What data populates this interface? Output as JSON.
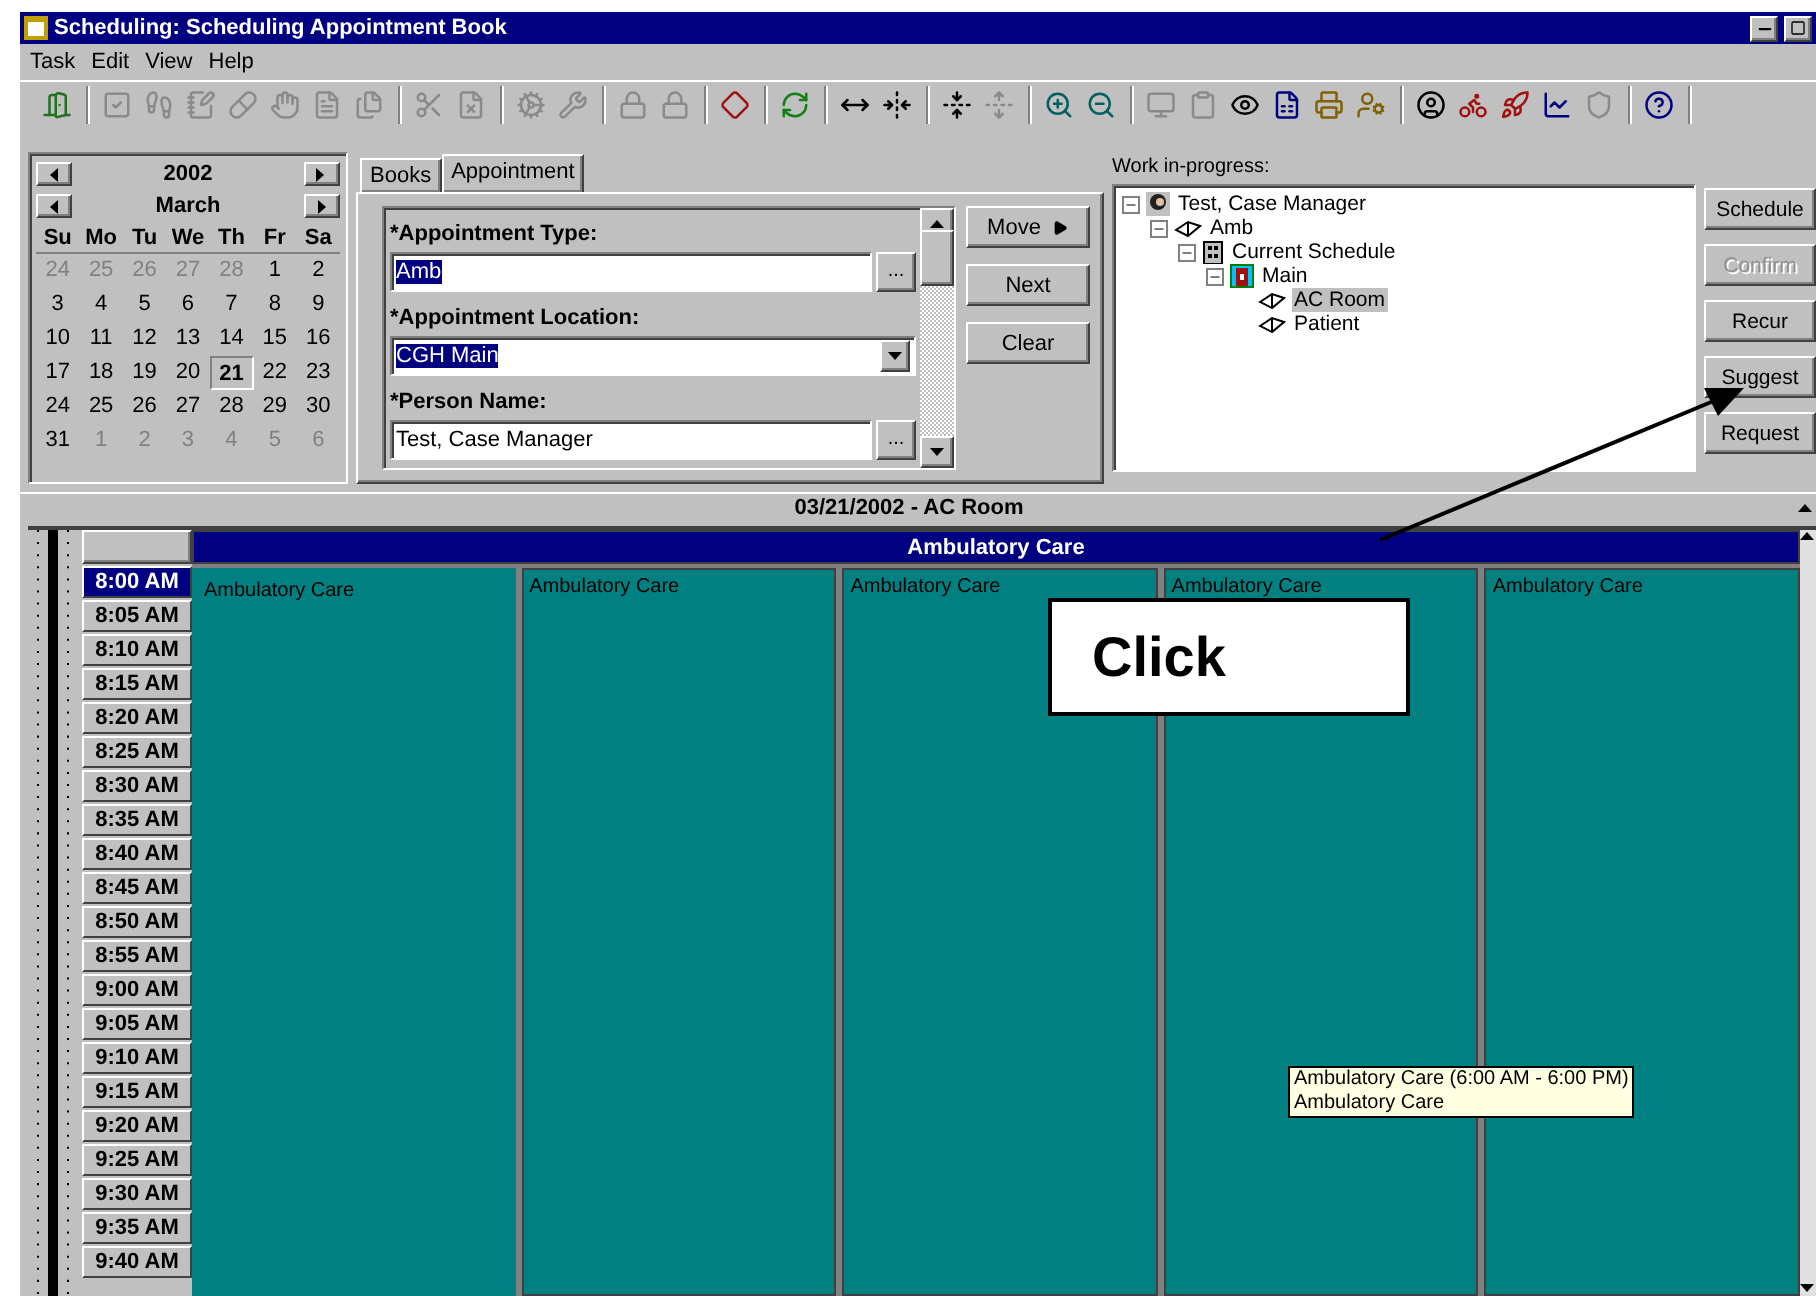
{
  "window": {
    "title": "Scheduling: Scheduling Appointment Book"
  },
  "menu": [
    "Task",
    "Edit",
    "View",
    "Help"
  ],
  "toolbar": [
    {
      "buttons": [
        {
          "disabled": false
        }
      ]
    },
    {
      "buttons": [
        {
          "disabled": true
        },
        {
          "disabled": true
        },
        {
          "disabled": true
        },
        {
          "disabled": true
        },
        {
          "disabled": true
        },
        {
          "disabled": true
        },
        {
          "disabled": true
        }
      ]
    },
    {
      "buttons": [
        {
          "disabled": true
        },
        {
          "disabled": true
        }
      ]
    },
    {
      "buttons": [
        {
          "disabled": true
        },
        {
          "disabled": true
        }
      ]
    },
    {
      "buttons": [
        {
          "disabled": true
        },
        {
          "disabled": true
        }
      ]
    },
    {
      "buttons": [
        {
          "disabled": false
        }
      ]
    },
    {
      "buttons": [
        {
          "disabled": false
        }
      ]
    },
    {
      "buttons": [
        {
          "disabled": false
        },
        {
          "disabled": false
        }
      ]
    },
    {
      "buttons": [
        {
          "disabled": false
        },
        {
          "disabled": true
        }
      ]
    },
    {
      "buttons": [
        {
          "disabled": false
        },
        {
          "disabled": false
        }
      ]
    },
    {
      "buttons": [
        {
          "disabled": true
        },
        {
          "disabled": true
        },
        {
          "disabled": false
        },
        {
          "disabled": false
        },
        {
          "disabled": false
        },
        {
          "disabled": false
        }
      ]
    },
    {
      "buttons": [
        {
          "disabled": false
        },
        {
          "disabled": false
        },
        {
          "disabled": false
        },
        {
          "disabled": false
        },
        {
          "disabled": true
        }
      ]
    },
    {
      "buttons": [
        {
          "disabled": false
        }
      ]
    }
  ],
  "calendar": {
    "year": "2002",
    "month": "March",
    "weekdays": [
      "Su",
      "Mo",
      "Tu",
      "We",
      "Th",
      "Fr",
      "Sa"
    ],
    "days": [
      {
        "label": "24",
        "other_month": true,
        "selected": false
      },
      {
        "label": "25",
        "other_month": true,
        "selected": false
      },
      {
        "label": "26",
        "other_month": true,
        "selected": false
      },
      {
        "label": "27",
        "other_month": true,
        "selected": false
      },
      {
        "label": "28",
        "other_month": true,
        "selected": false
      },
      {
        "label": "1",
        "other_month": false,
        "selected": false
      },
      {
        "label": "2",
        "other_month": false,
        "selected": false
      },
      {
        "label": "3",
        "other_month": false,
        "selected": false
      },
      {
        "label": "4",
        "other_month": false,
        "selected": false
      },
      {
        "label": "5",
        "other_month": false,
        "selected": false
      },
      {
        "label": "6",
        "other_month": false,
        "selected": false
      },
      {
        "label": "7",
        "other_month": false,
        "selected": false
      },
      {
        "label": "8",
        "other_month": false,
        "selected": false
      },
      {
        "label": "9",
        "other_month": false,
        "selected": false
      },
      {
        "label": "10",
        "other_month": false,
        "selected": false
      },
      {
        "label": "11",
        "other_month": false,
        "selected": false
      },
      {
        "label": "12",
        "other_month": false,
        "selected": false
      },
      {
        "label": "13",
        "other_month": false,
        "selected": false
      },
      {
        "label": "14",
        "other_month": false,
        "selected": false
      },
      {
        "label": "15",
        "other_month": false,
        "selected": false
      },
      {
        "label": "16",
        "other_month": false,
        "selected": false
      },
      {
        "label": "17",
        "other_month": false,
        "selected": false
      },
      {
        "label": "18",
        "other_month": false,
        "selected": false
      },
      {
        "label": "19",
        "other_month": false,
        "selected": false
      },
      {
        "label": "20",
        "other_month": false,
        "selected": false
      },
      {
        "label": "21",
        "other_month": false,
        "selected": true
      },
      {
        "label": "22",
        "other_month": false,
        "selected": false
      },
      {
        "label": "23",
        "other_month": false,
        "selected": false
      },
      {
        "label": "24",
        "other_month": false,
        "selected": false
      },
      {
        "label": "25",
        "other_month": false,
        "selected": false
      },
      {
        "label": "26",
        "other_month": false,
        "selected": false
      },
      {
        "label": "27",
        "other_month": false,
        "selected": false
      },
      {
        "label": "28",
        "other_month": false,
        "selected": false
      },
      {
        "label": "29",
        "other_month": false,
        "selected": false
      },
      {
        "label": "30",
        "other_month": false,
        "selected": false
      },
      {
        "label": "31",
        "other_month": false,
        "selected": false
      },
      {
        "label": "1",
        "other_month": true,
        "selected": false
      },
      {
        "label": "2",
        "other_month": true,
        "selected": false
      },
      {
        "label": "3",
        "other_month": true,
        "selected": false
      },
      {
        "label": "4",
        "other_month": true,
        "selected": false
      },
      {
        "label": "5",
        "other_month": true,
        "selected": false
      },
      {
        "label": "6",
        "other_month": true,
        "selected": false
      }
    ]
  },
  "tabs": [
    {
      "label": "Books",
      "selected": false
    },
    {
      "label": "Appointment",
      "selected": true
    }
  ],
  "form": {
    "fields": [
      {
        "label": "*Appointment Type:",
        "value": "Amb",
        "kind": "lookup",
        "highlighted": true,
        "button": "..."
      },
      {
        "label": "*Appointment Location:",
        "value": "CGH Main",
        "kind": "dropdown",
        "highlighted": true
      },
      {
        "label": "*Person Name:",
        "value": "Test, Case Manager",
        "kind": "lookup",
        "highlighted": false,
        "button": "..."
      }
    ]
  },
  "form_buttons": [
    {
      "label": "Move",
      "arrow": true
    },
    {
      "label": "Next",
      "arrow": false
    },
    {
      "label": "Clear",
      "arrow": false
    }
  ],
  "work_in_progress": {
    "label": "Work in-progress:",
    "tree": [
      {
        "label": "Test, Case Manager",
        "kind": "person",
        "selected": false,
        "expanded": true,
        "children": [
          {
            "label": "Amb",
            "kind": "book",
            "selected": false,
            "expanded": true,
            "children": [
              {
                "label": "Current Schedule",
                "kind": "building",
                "selected": false,
                "expanded": true,
                "children": [
                  {
                    "label": "Main",
                    "kind": "location",
                    "selected": false,
                    "expanded": true,
                    "children": [
                      {
                        "label": "AC Room",
                        "kind": "book",
                        "selected": true
                      },
                      {
                        "label": "Patient",
                        "kind": "book",
                        "selected": false
                      }
                    ]
                  }
                ]
              }
            ]
          }
        ]
      }
    ]
  },
  "side_buttons": [
    {
      "label": "Schedule",
      "disabled": false
    },
    {
      "label": "Confirm",
      "disabled": true
    },
    {
      "label": "Recur",
      "disabled": false
    },
    {
      "label": "Suggest",
      "disabled": false
    },
    {
      "label": "Request",
      "disabled": false
    }
  ],
  "schedule": {
    "title": "03/21/2002 - AC Room",
    "header": "Ambulatory Care",
    "times": [
      {
        "label": "8:00 AM",
        "selected": true
      },
      {
        "label": "8:05 AM",
        "selected": false
      },
      {
        "label": "8:10 AM",
        "selected": false
      },
      {
        "label": "8:15 AM",
        "selected": false
      },
      {
        "label": "8:20 AM",
        "selected": false
      },
      {
        "label": "8:25 AM",
        "selected": false
      },
      {
        "label": "8:30 AM",
        "selected": false
      },
      {
        "label": "8:35 AM",
        "selected": false
      },
      {
        "label": "8:40 AM",
        "selected": false
      },
      {
        "label": "8:45 AM",
        "selected": false
      },
      {
        "label": "8:50 AM",
        "selected": false
      },
      {
        "label": "8:55 AM",
        "selected": false
      },
      {
        "label": "9:00 AM",
        "selected": false
      },
      {
        "label": "9:05 AM",
        "selected": false
      },
      {
        "label": "9:10 AM",
        "selected": false
      },
      {
        "label": "9:15 AM",
        "selected": false
      },
      {
        "label": "9:20 AM",
        "selected": false
      },
      {
        "label": "9:25 AM",
        "selected": false
      },
      {
        "label": "9:30 AM",
        "selected": false
      },
      {
        "label": "9:35 AM",
        "selected": false
      },
      {
        "label": "9:40 AM",
        "selected": false
      }
    ],
    "columns": [
      {
        "label": "Ambulatory Care",
        "selected": true
      },
      {
        "label": "Ambulatory Care",
        "selected": false
      },
      {
        "label": "Ambulatory Care",
        "selected": false
      },
      {
        "label": "Ambulatory Care",
        "selected": false
      },
      {
        "label": "Ambulatory Care",
        "selected": false
      }
    ],
    "tooltip": [
      "Ambulatory Care (6:00 AM - 6:00 PM)",
      "Ambulatory Care"
    ]
  },
  "callout": {
    "label": "Click"
  }
}
